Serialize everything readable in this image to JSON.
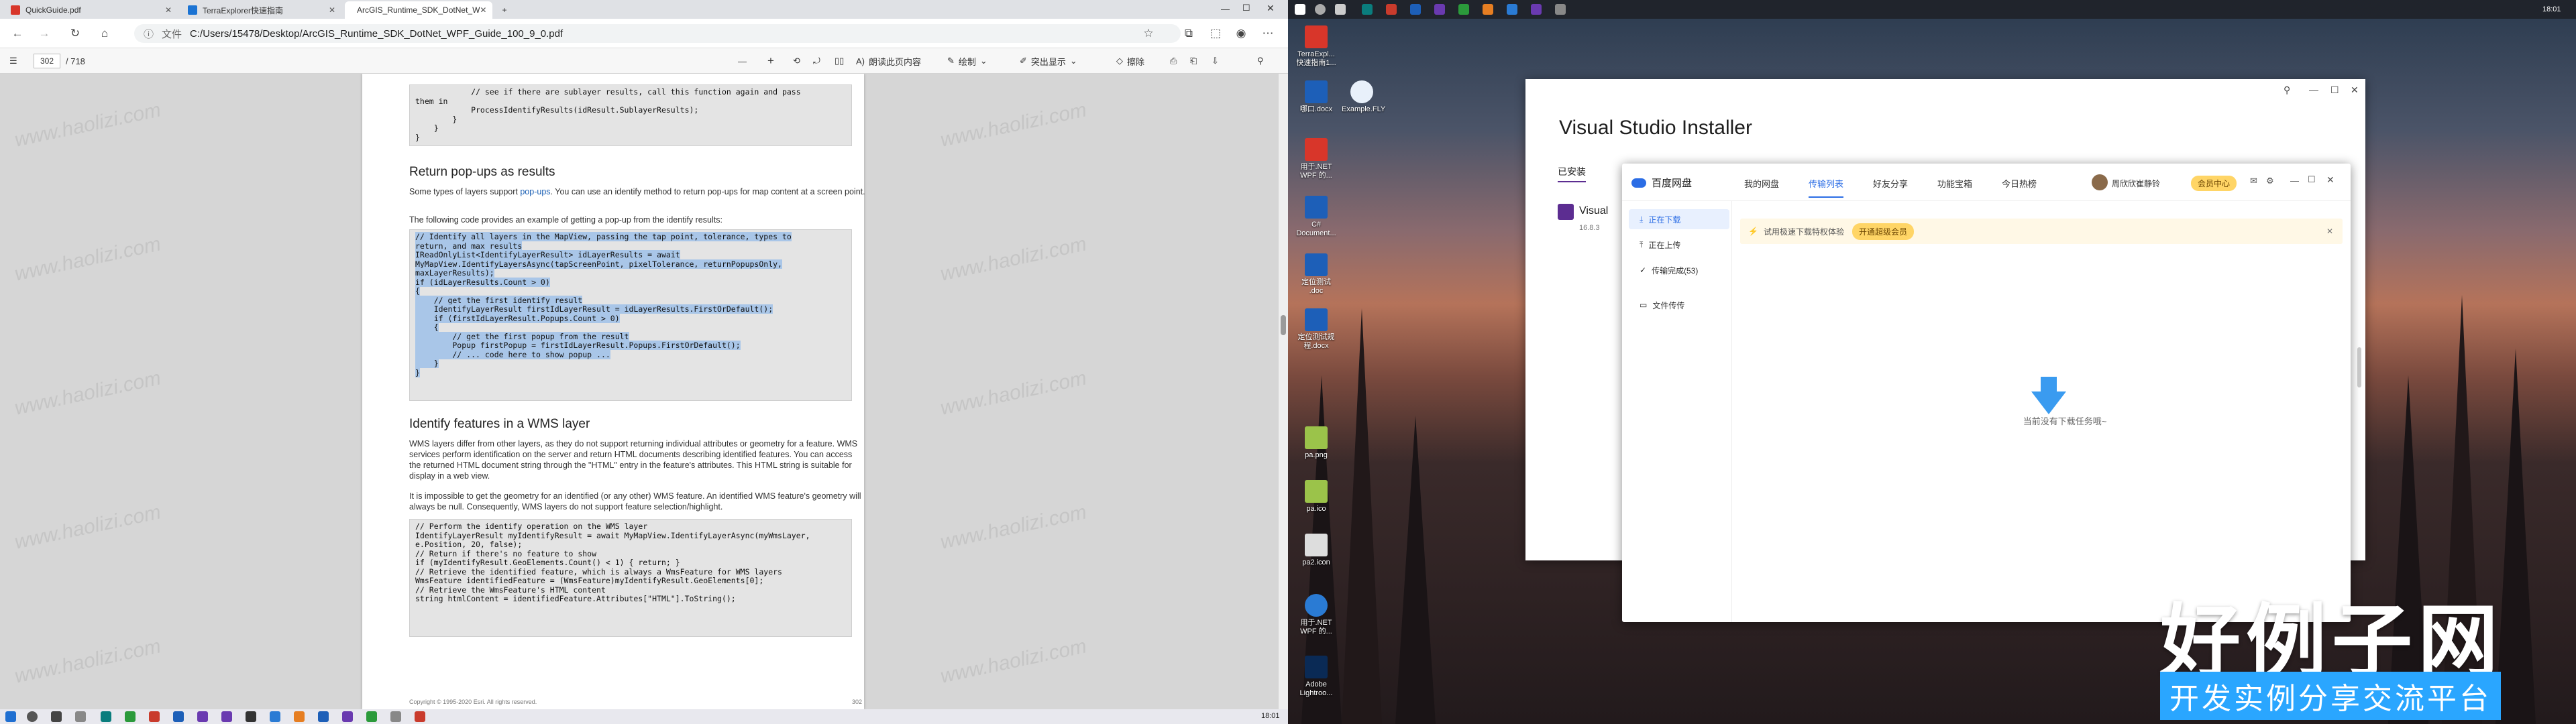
{
  "browser": {
    "tabs": [
      {
        "label": "QuickGuide.pdf"
      },
      {
        "label": "TerraExplorer快速指南"
      },
      {
        "label": "ArcGIS_Runtime_SDK_DotNet_W"
      }
    ],
    "new_tab": "+",
    "file_label": "文件",
    "url": "C:/Users/15478/Desktop/ArcGIS_Runtime_SDK_DotNet_WPF_Guide_100_9_0.pdf",
    "toolbar": {
      "page_current": "302",
      "page_total": "/ 718",
      "read_aloud": "朗读此页内容",
      "draw": "绘制",
      "highlight": "突出显示",
      "erase": "擦除",
      "zoom_out": "—",
      "zoom_in": "+"
    }
  },
  "pdf": {
    "code_top": [
      "            // see if there are sublayer results, call this function again and pass",
      "them in",
      "            ProcessIdentifyResults(idResult.SublayerResults);",
      "        }",
      "    }",
      "}"
    ],
    "heading_popups": "Return pop-ups as results",
    "para_popups_1a": "Some types of layers support ",
    "para_popups_1_link": "pop-ups",
    "para_popups_1b": ". You can use an identify method to return pop-ups for map content at a screen point.",
    "para_popups_2": "The following code provides an example of getting a pop-up from the identify results:",
    "code_popups": [
      "// Identify all layers in the MapView, passing the tap point, tolerance, types to",
      "return, and max results",
      "IReadOnlyList<IdentifyLayerResult> idLayerResults = await",
      "MyMapView.IdentifyLayersAsync(tapScreenPoint, pixelTolerance, returnPopupsOnly,",
      "maxLayerResults);",
      "if (idLayerResults.Count > 0)",
      "{",
      "    // get the first identify result",
      "    IdentifyLayerResult firstIdLayerResult = idLayerResults.FirstOrDefault();",
      "",
      "    if (firstIdLayerResult.Popups.Count > 0)",
      "    {",
      "        // get the first popup from the result",
      "        Popup firstPopup = firstIdLayerResult.Popups.FirstOrDefault();",
      "",
      "        // ... code here to show popup ...",
      "    }",
      "}"
    ],
    "heading_wms": "Identify features in a WMS layer",
    "para_wms_1": "WMS layers differ from other layers, as they do not support returning individual attributes or geometry for a feature. WMS services perform identification on the server and return HTML documents describing identified features. You can access the returned HTML document string through the \"HTML\" entry in the feature's attributes. This HTML string is suitable for display in a web view.",
    "para_wms_2": "It is impossible to get the geometry for an identified (or any other) WMS feature. An identified WMS feature's geometry will always be null. Consequently, WMS layers do not support feature selection/highlight.",
    "code_wms": [
      "// Perform the identify operation on the WMS layer",
      "IdentifyLayerResult myIdentifyResult = await MyMapView.IdentifyLayerAsync(myWmsLayer,",
      "e.Position, 20, false);",
      "",
      "// Return if there's no feature to show",
      "if (myIdentifyResult.GeoElements.Count() < 1) { return; }",
      "",
      "// Retrieve the identified feature, which is always a WmsFeature for WMS layers",
      "WmsFeature identifiedFeature = (WmsFeature)myIdentifyResult.GeoElements[0];",
      "",
      "// Retrieve the WmsFeature's HTML content",
      "string htmlContent = identifiedFeature.Attributes[\"HTML\"].ToString();"
    ],
    "footer_copy": "Copyright © 1995-2020 Esri. All rights reserved.",
    "footer_page": "302",
    "watermark": "www.haolizi.com"
  },
  "left_clock": "18:01",
  "right_clock": "18:01",
  "desktop_icons": [
    {
      "label": "TerraExpl... 快速指南1..."
    },
    {
      "label": "哪口.docx"
    },
    {
      "label": "Example.FLY"
    },
    {
      "label": "用于.NET WPF 的..."
    },
    {
      "label": "C# Document..."
    },
    {
      "label": "定位测试 .doc"
    },
    {
      "label": "定位测试规程.docx"
    },
    {
      "label": "pa.png"
    },
    {
      "label": "pa.ico"
    },
    {
      "label": "pa2.icon"
    },
    {
      "label": "用于.NET WPF 的..."
    },
    {
      "label": "Adobe Lightroo..."
    }
  ],
  "vs_installer": {
    "title": "Visual Studio Installer",
    "tab_installed": "已安装",
    "item_name": "Visual",
    "item_version": "16.8.3"
  },
  "baidu": {
    "app_name": "百度网盘",
    "nav": [
      "我的网盘",
      "传输列表",
      "好友分享",
      "功能宝箱",
      "今日热榜"
    ],
    "user": "周欣欣崔静铃",
    "vip_center": "会员中心",
    "side": [
      "正在下载",
      "正在上传",
      "传输完成(53)",
      "文件传传"
    ],
    "banner_text": "试用极速下载特权体验",
    "banner_btn": "开通超级会员",
    "banner_close": "✕",
    "empty_text": "当前没有下载任务哦~"
  },
  "site_watermark": {
    "title": "好例子网",
    "subtitle": "开发实例分享交流平台"
  }
}
